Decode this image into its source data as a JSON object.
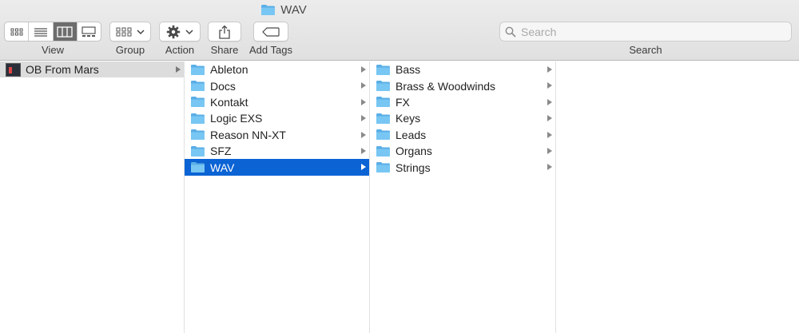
{
  "window": {
    "title": "WAV",
    "title_icon": "folder-icon"
  },
  "toolbar": {
    "view_label": "View",
    "view_modes": [
      {
        "name": "icon-view",
        "icon": "grid-icon",
        "active": false
      },
      {
        "name": "list-view",
        "icon": "list-icon",
        "active": false
      },
      {
        "name": "column-view",
        "icon": "columns-icon",
        "active": true
      },
      {
        "name": "gallery-view",
        "icon": "gallery-icon",
        "active": false
      }
    ],
    "group_label": "Group",
    "action_label": "Action",
    "share_label": "Share",
    "tags_label": "Add Tags",
    "search_label": "Search",
    "search_placeholder": "Search",
    "search_value": ""
  },
  "columns": {
    "col1": [
      {
        "name": "OB From Mars",
        "icon": "album-thumbnail-icon",
        "has_children": true,
        "selected": "inactive"
      }
    ],
    "col2": [
      {
        "name": "Ableton",
        "icon": "folder-icon",
        "has_children": true
      },
      {
        "name": "Docs",
        "icon": "folder-icon",
        "has_children": true
      },
      {
        "name": "Kontakt",
        "icon": "folder-icon",
        "has_children": true
      },
      {
        "name": "Logic EXS",
        "icon": "folder-icon",
        "has_children": true
      },
      {
        "name": "Reason NN-XT",
        "icon": "folder-icon",
        "has_children": true
      },
      {
        "name": "SFZ",
        "icon": "folder-icon",
        "has_children": true
      },
      {
        "name": "WAV",
        "icon": "folder-icon",
        "has_children": true,
        "selected": "active"
      }
    ],
    "col3": [
      {
        "name": "Bass",
        "icon": "folder-icon",
        "has_children": true
      },
      {
        "name": "Brass & Woodwinds",
        "icon": "folder-icon",
        "has_children": true
      },
      {
        "name": "FX",
        "icon": "folder-icon",
        "has_children": true
      },
      {
        "name": "Keys",
        "icon": "folder-icon",
        "has_children": true
      },
      {
        "name": "Leads",
        "icon": "folder-icon",
        "has_children": true
      },
      {
        "name": "Organs",
        "icon": "folder-icon",
        "has_children": true
      },
      {
        "name": "Strings",
        "icon": "folder-icon",
        "has_children": true
      }
    ],
    "col4": []
  },
  "colors": {
    "selection_active": "#0b63d4",
    "selection_inactive": "#dcdcdc",
    "folder_fill": "#6cc0f2",
    "folder_tab": "#5aaee6"
  }
}
